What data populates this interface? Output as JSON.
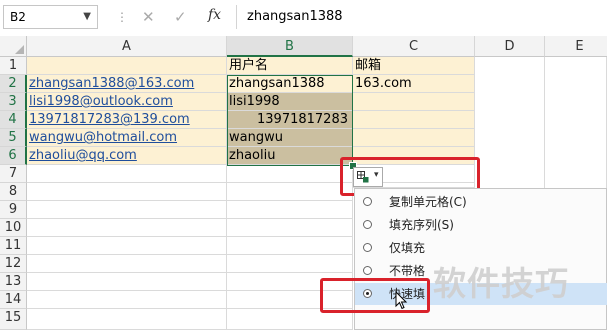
{
  "formula_bar": {
    "name_box": "B2",
    "cancel_glyph": "✕",
    "enter_glyph": "✓",
    "fx_label": "fx",
    "content": "zhangsan1388"
  },
  "columns": [
    "A",
    "B",
    "C",
    "D",
    "E"
  ],
  "rows": [
    "1",
    "2",
    "3",
    "4",
    "5",
    "6",
    "7",
    "8",
    "9",
    "10",
    "11",
    "12",
    "13",
    "14",
    "15"
  ],
  "cells": {
    "b1": "用户名",
    "c1": "邮箱",
    "a2": "zhangsan1388@163.com",
    "b2": "zhangsan1388",
    "c2": "163.com",
    "a3": "lisi1998@outlook.com",
    "b3": "lisi1998",
    "a4": "13971817283@139.com",
    "b4": "13971817283",
    "a5": "wangwu@hotmail.com",
    "b5": "wangwu",
    "a6": "zhaoliu@qq.com",
    "b6": "zhaoliu"
  },
  "autofill_menu": {
    "items": [
      {
        "label": "复制单元格(C)",
        "selected": false
      },
      {
        "label": "填充序列(S)",
        "selected": false
      },
      {
        "label": "仅填充",
        "selected": false
      },
      {
        "label": "不带格",
        "selected": false
      },
      {
        "label": "快速填",
        "selected": true
      }
    ]
  },
  "watermark": "软件技巧",
  "colors": {
    "accent": "#217346",
    "highlight_red": "#d9222b",
    "fill_cream": "#fdf1d3",
    "selected_fill": "#cbbfa0",
    "link_blue": "#1f4e9c"
  },
  "icons": {
    "autofill_options": "flash-fill-options-icon",
    "dropdown": "chevron-down-icon",
    "cursor": "mouse-pointer-icon"
  }
}
